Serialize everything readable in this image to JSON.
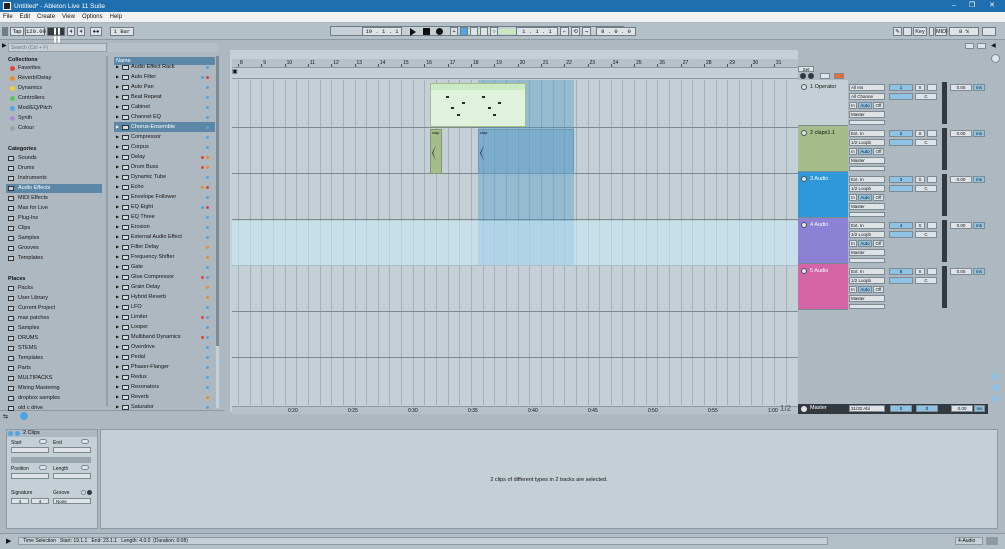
{
  "window": {
    "title": "Untitled* - Ableton Live 11 Suite"
  },
  "menu": [
    "File",
    "Edit",
    "Create",
    "View",
    "Options",
    "Help"
  ],
  "control": {
    "tap": "Tap",
    "tempo": "120.00",
    "signature_num": "4",
    "signature_den": "4",
    "quantize": "1 Bar",
    "position": "19 .  1 .  1",
    "loop_start": "1 .  1 .  1",
    "loop_len": "8 .  0 .  0",
    "key": "Key",
    "midi": "MIDI",
    "cpu": "8 %"
  },
  "browser": {
    "search_placeholder": "Search (Ctrl + F)",
    "collections_title": "Collections",
    "collections": [
      {
        "label": "Favorites",
        "color": "#e4423a"
      },
      {
        "label": "Reverb/Delay",
        "color": "#f08a24"
      },
      {
        "label": "Dynamics",
        "color": "#f3d22b"
      },
      {
        "label": "Controllers",
        "color": "#5bc95a"
      },
      {
        "label": "Mod/EQ/Pitch",
        "color": "#4fa4e6"
      },
      {
        "label": "Synth",
        "color": "#b28ad8"
      },
      {
        "label": "Colour",
        "color": "#9aa3a8"
      }
    ],
    "categories_title": "Categories",
    "categories": [
      "Sounds",
      "Drums",
      "Instruments",
      "Audio Effects",
      "MIDI Effects",
      "Max for Live",
      "Plug-Ins",
      "Clips",
      "Samples",
      "Grooves",
      "Templates"
    ],
    "places_title": "Places",
    "places": [
      "Packs",
      "User Library",
      "Current Project",
      "max patches",
      "Samples",
      "DRUMS",
      "STEMS",
      "Templates",
      "Parts",
      "MULTIPACKS",
      "Mixing Mastering",
      "dropbox samples",
      "old c drive"
    ],
    "items_header": "Name",
    "items": [
      {
        "label": "Audio Effect Rack",
        "led": "#4fa4e6"
      },
      {
        "label": "Auto Filter",
        "led": "#e4423a",
        "led2": "#4fa4e6"
      },
      {
        "label": "Auto Pan",
        "led": "#4fa4e6"
      },
      {
        "label": "Beat Repeat",
        "led": "#4fa4e6"
      },
      {
        "label": "Cabinet",
        "led": "#4fa4e6"
      },
      {
        "label": "Channel EQ",
        "led": "#4fa4e6"
      },
      {
        "label": "Chorus-Ensemble",
        "led": "#4fa4e6"
      },
      {
        "label": "Compressor",
        "led": "#4fa4e6"
      },
      {
        "label": "Corpus",
        "led": "#4fa4e6"
      },
      {
        "label": "Delay",
        "led": "#f08a24",
        "led2": "#e4423a"
      },
      {
        "label": "Drum Buss",
        "led": "#f08a24",
        "led2": "#e4423a"
      },
      {
        "label": "Dynamic Tube",
        "led": "#4fa4e6"
      },
      {
        "label": "Echo",
        "led": "#e4423a",
        "led2": "#f08a24"
      },
      {
        "label": "Envelope Follower",
        "led": "#4fa4e6"
      },
      {
        "label": "EQ Eight",
        "led": "#e4423a",
        "led2": "#4fa4e6"
      },
      {
        "label": "EQ Three",
        "led": "#4fa4e6"
      },
      {
        "label": "Erosion",
        "led": "#4fa4e6"
      },
      {
        "label": "External Audio Effect",
        "led": "#4fa4e6"
      },
      {
        "label": "Filter Delay",
        "led": "#f08a24"
      },
      {
        "label": "Frequency Shifter",
        "led": "#f08a24"
      },
      {
        "label": "Gate",
        "led": "#4fa4e6"
      },
      {
        "label": "Glue Compressor",
        "led": "#4fa4e6",
        "led2": "#e4423a"
      },
      {
        "label": "Grain Delay",
        "led": "#f08a24"
      },
      {
        "label": "Hybrid Reverb",
        "led": "#f08a24"
      },
      {
        "label": "LFO",
        "led": "#4fa4e6"
      },
      {
        "label": "Limiter",
        "led": "#4fa4e6",
        "led2": "#e4423a"
      },
      {
        "label": "Looper",
        "led": "#4fa4e6"
      },
      {
        "label": "Multiband Dynamics",
        "led": "#4fa4e6",
        "led2": "#e4423a"
      },
      {
        "label": "Overdrive",
        "led": "#4fa4e6"
      },
      {
        "label": "Pedal",
        "led": "#4fa4e6"
      },
      {
        "label": "Phaser-Flanger",
        "led": "#4fa4e6"
      },
      {
        "label": "Redux",
        "led": "#4fa4e6"
      },
      {
        "label": "Resonators",
        "led": "#4fa4e6"
      },
      {
        "label": "Reverb",
        "led": "#f08a24"
      },
      {
        "label": "Saturator",
        "led": "#4fa4e6"
      }
    ]
  },
  "ruler": {
    "bars": [
      "9",
      "11",
      "13",
      "15",
      "17",
      "19",
      "21",
      "23",
      "25",
      "27",
      "29",
      "31"
    ],
    "bars_all": [
      "8",
      "9",
      "10",
      "11",
      "12",
      "13",
      "14",
      "15",
      "16",
      "17",
      "18",
      "19",
      "20",
      "21",
      "22",
      "23",
      "24",
      "25",
      "26",
      "27",
      "28",
      "29",
      "30",
      "31"
    ],
    "times": [
      "0:20",
      "0:25",
      "0:30",
      "0:35",
      "0:40",
      "0:45",
      "0:50",
      "0:55",
      "1:00"
    ],
    "page": "1/2"
  },
  "tracks": [
    {
      "num": "1",
      "name": "1 Operator",
      "color": "#c5d0d6",
      "io1": "All Ins",
      "io2": "All Channe",
      "io3": "Master",
      "act": "1"
    },
    {
      "num": "2",
      "name": "2 claps1.1",
      "color": "#a4bd8a",
      "io1": "Ext. In",
      "io2": "1/2 Loopb",
      "io3": "Master",
      "act": "2"
    },
    {
      "num": "3",
      "name": "3 Audio",
      "color": "#2f98d8",
      "io1": "Ext. In",
      "io2": "1/2 Loopb",
      "io3": "Master",
      "act": "3"
    },
    {
      "num": "4",
      "name": "4 Audio",
      "color": "#8b82d6",
      "io1": "Ext. In",
      "io2": "1/2 Loopb",
      "io3": "Master",
      "act": "4"
    },
    {
      "num": "5",
      "name": "5 Audio",
      "color": "#d466a8",
      "io1": "Ext. In",
      "io2": "1/2 Loopb",
      "io3": "Master",
      "act": "5"
    }
  ],
  "mixer": {
    "in": "In",
    "auto": "Auto",
    "off": "Off",
    "send": "C",
    "s": "S",
    "vol": "0.00",
    "ms": "ms",
    "master": "Master",
    "master_io": "31/32 Abl",
    "master_vol": "0",
    "set": "Set"
  },
  "clips": {
    "clap1": "clap",
    "clap2": "clap"
  },
  "detail": {
    "header": "2 Clips",
    "start": "Start",
    "end": "End",
    "position": "Position",
    "length": "Length",
    "signature": "Signature",
    "groove": "Groove",
    "sig_num": "4",
    "sig_den": "4",
    "groove_val": "None",
    "message": "2 clips of different types in 2 tracks are selected."
  },
  "status": {
    "text": "Time Selection   Start: 19.1.1   End: 23.1.1   Length: 4.0.0  (Duration: 0:08)",
    "track": "4-Audio"
  }
}
